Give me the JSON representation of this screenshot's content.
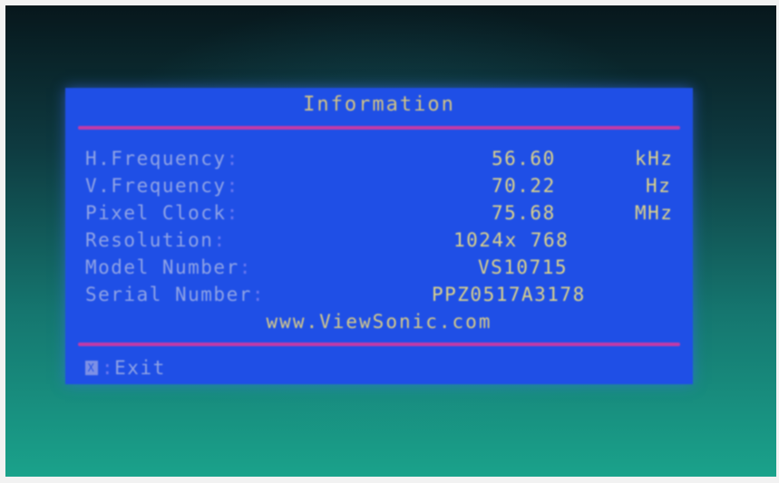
{
  "osd": {
    "title": "Information",
    "rows": [
      {
        "label": "H.Frequency",
        "value": "56.60",
        "unit": "kHz"
      },
      {
        "label": "V.Frequency",
        "value": "70.22",
        "unit": "Hz"
      },
      {
        "label": "Pixel Clock",
        "value": "75.68",
        "unit": "MHz"
      },
      {
        "label": "Resolution",
        "value": "1024x 768",
        "unit": ""
      },
      {
        "label": "Model Number",
        "value": "VS10715",
        "unit": ""
      },
      {
        "label": "Serial Number",
        "value": "PPZ0517A3178",
        "unit": ""
      }
    ],
    "separator": ":",
    "website": "www.ViewSonic.com",
    "exit": {
      "key": "X",
      "label": "Exit"
    }
  },
  "colors": {
    "osd_background": "#1f4fe6",
    "label_text": "#8fa3e6",
    "value_text": "#ddd38a",
    "divider": "#c23aa8"
  }
}
